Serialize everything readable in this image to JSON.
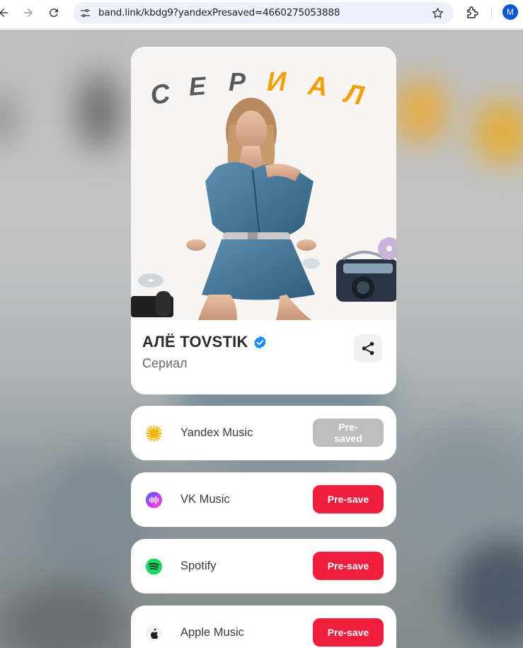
{
  "browser": {
    "url": "band.link/kbdg9?yandexPresaved=4660275053888",
    "profile_initial": "M"
  },
  "release": {
    "cover_title": "СЕРИАЛ",
    "artist": "АЛЁ TOVSTIK",
    "title": "Сериал",
    "verified": true
  },
  "services": [
    {
      "name": "Yandex Music",
      "button": "Pre-saved",
      "state": "done",
      "icon": "yandex-music-icon"
    },
    {
      "name": "VK Music",
      "button": "Pre-save",
      "state": "active",
      "icon": "vk-music-icon"
    },
    {
      "name": "Spotify",
      "button": "Pre-save",
      "state": "active",
      "icon": "spotify-icon"
    },
    {
      "name": "Apple Music",
      "button": "Pre-save",
      "state": "active",
      "icon": "apple-icon"
    }
  ],
  "colors": {
    "accent": "#ef1e3c",
    "disabled": "#bdbdbd",
    "verified": "#1d8cf8",
    "cover_lettering_dark": "#5a5a5a",
    "cover_lettering_orange": "#f2a007"
  }
}
